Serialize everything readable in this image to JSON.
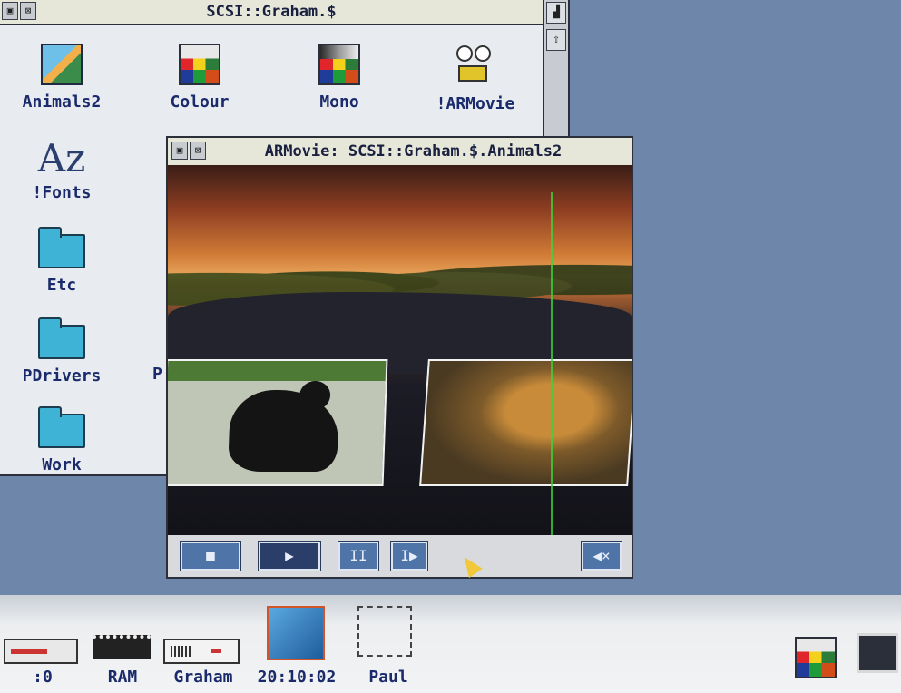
{
  "filer": {
    "title": "SCSI::Graham.$",
    "icons": [
      {
        "label": "Animals2",
        "icon": "picture-icon"
      },
      {
        "label": "Colour",
        "icon": "colour-palette-icon"
      },
      {
        "label": "Mono",
        "icon": "mono-palette-icon"
      },
      {
        "label": "!ARMovie",
        "icon": "projector-icon"
      },
      {
        "label": "!Fonts",
        "icon": "fonts-icon"
      },
      {
        "label": "Etc",
        "icon": "folder-icon"
      },
      {
        "label": "PDrivers",
        "icon": "folder-icon"
      },
      {
        "label": "Work",
        "icon": "folder-icon"
      }
    ],
    "fonts_glyph": "Az",
    "partial_label_p": "P"
  },
  "movie_window": {
    "title": "ARMovie: SCSI::Graham.$.Animals2",
    "controls": {
      "stop": "■",
      "play": "▶",
      "pause": "II",
      "step": "I▶",
      "mute": "◀×"
    }
  },
  "iconbar": {
    "items": [
      {
        "label": ":0",
        "icon": "floppy-drive-icon"
      },
      {
        "label": "RAM",
        "icon": "ram-disc-icon"
      },
      {
        "label": "Graham",
        "icon": "hard-disc-icon"
      },
      {
        "label": "20:10:02",
        "icon": "clock-filer-icon"
      },
      {
        "label": "Paul",
        "icon": "network-icon"
      }
    ]
  },
  "colors": {
    "desktop": "#6d86aa",
    "label_text": "#1a2a6b",
    "button": "#4e74a8",
    "folder": "#3fb3d6"
  }
}
